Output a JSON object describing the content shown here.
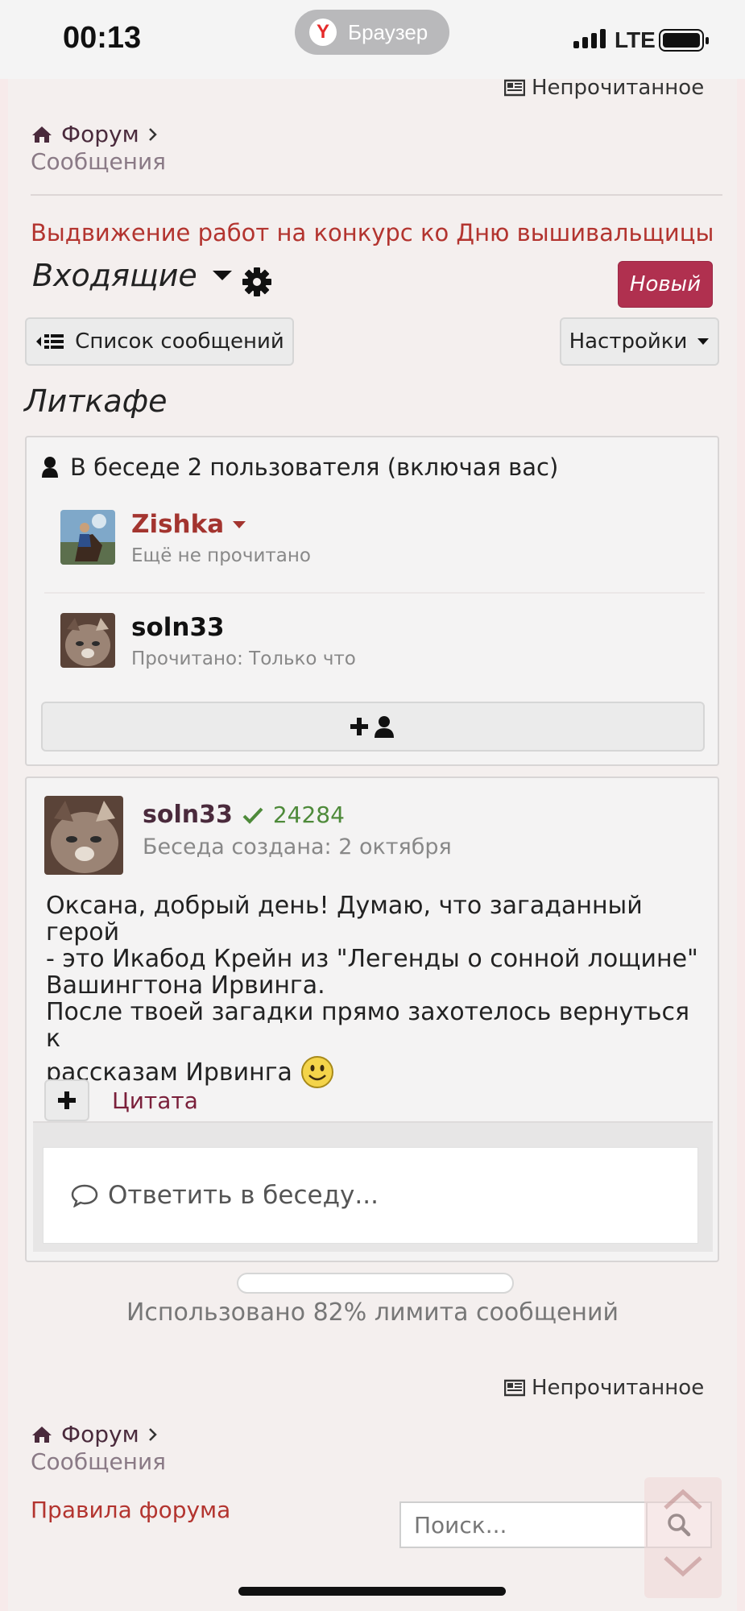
{
  "status_bar": {
    "time": "00:13",
    "browser_label": "Браузер",
    "browser_logo_letter": "Y",
    "network": "LTE"
  },
  "top_nav": {
    "unread_label": "Непрочитанное",
    "breadcrumb_forum": "Форум",
    "breadcrumb_messages": "Сообщения"
  },
  "conversation": {
    "title": "Выдвижение работ на конкурс ко Дню вышивальщицы",
    "folder_label": "Входящие",
    "new_button": "Новый",
    "list_button": "Список сообщений",
    "settings_button": "Настройки",
    "section_title": "Литкафе"
  },
  "participants": {
    "header": "В беседе 2 пользователя (включая вас)",
    "users": [
      {
        "name": "Zishka",
        "status": "Ещё не прочитано",
        "name_color": "#a3342f"
      },
      {
        "name": "soln33",
        "status": "Прочитано: Только что",
        "name_color": "#111111"
      }
    ]
  },
  "message": {
    "author": "soln33",
    "score": "24284",
    "created": "Беседа создана: 2 октября",
    "text_lines": [
      "Оксана, добрый день! Думаю, что загаданный герой",
      "- это Икабод Крейн из \"Легенды о сонной лощине\"",
      "Вашингтона Ирвинга.",
      "После твоей загадки прямо захотелось вернуться к",
      "рассказам Ирвинга"
    ],
    "quote_label": "Цитата",
    "reply_placeholder": "Ответить в беседу..."
  },
  "quota": {
    "label": "Использовано 82% лимита сообщений",
    "used_fraction": 0.82
  },
  "bottom_nav": {
    "unread_label": "Непрочитанное",
    "breadcrumb_forum": "Форум",
    "breadcrumb_messages": "Сообщения",
    "rules_link": "Правила форума",
    "search_placeholder": "Поиск..."
  },
  "colors": {
    "accent": "#b0304f",
    "title_red": "#b3342f",
    "link_dark": "#4a2a3c",
    "verified_green": "#4e8a3a"
  },
  "icons": [
    "home-icon",
    "newspaper-icon",
    "caret-down-icon",
    "gear-icon",
    "list-icon",
    "user-icon",
    "add-user-icon",
    "check-icon",
    "smiley-icon",
    "plus-icon",
    "comment-icon",
    "search-icon",
    "chevron-up-icon",
    "chevron-down-icon"
  ]
}
